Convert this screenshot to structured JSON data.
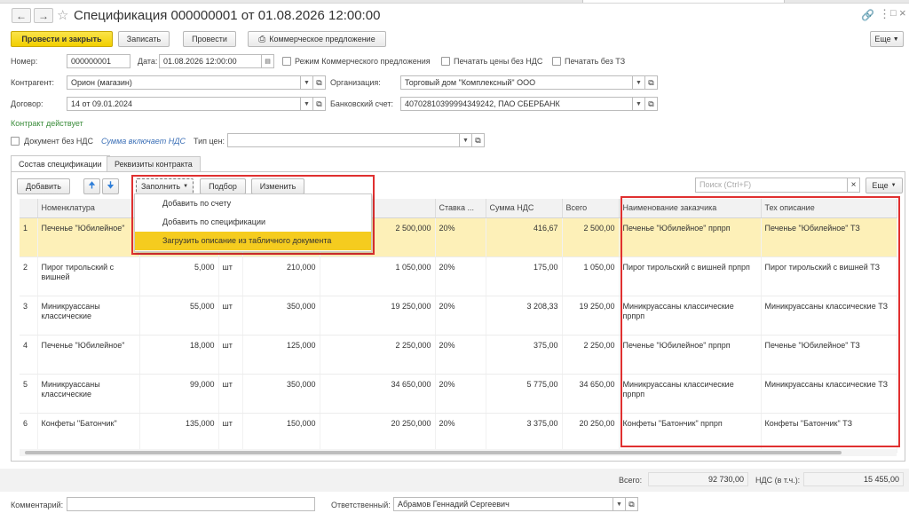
{
  "window": {
    "title": "Спецификация 000000001 от 01.08.2026 12:00:00"
  },
  "toolbar": {
    "post_close": "Провести и закрыть",
    "save": "Записать",
    "post": "Провести",
    "offer": "Коммерческое предложение",
    "more": "Еще"
  },
  "header": {
    "number_label": "Номер:",
    "number_value": "000000001",
    "date_label": "Дата:",
    "date_value": "01.08.2026 12:00:00",
    "commercial_mode": "Режим Коммерческого предложения",
    "print_no_vat": "Печатать цены без НДС",
    "print_no_tz": "Печатать без ТЗ",
    "counterparty_label": "Контрагент:",
    "counterparty_value": "Орион (магазин)",
    "organization_label": "Организация:",
    "organization_value": "Торговый дом \"Комплексный\" ООО",
    "contract_label": "Договор:",
    "contract_value": "14 от 09.01.2024",
    "bank_label": "Банковский счет:",
    "bank_value": "40702810399994349242, ПАО СБЕРБАНК",
    "contract_status": "Контракт действует",
    "doc_no_vat": "Документ без НДС",
    "sum_incl_vat": "Сумма включает НДС",
    "price_type_label": "Тип цен:"
  },
  "tabs": [
    "Состав спецификации",
    "Реквизиты контракта"
  ],
  "table_toolbar": {
    "add": "Добавить",
    "fill": "Заполнить",
    "pick": "Подбор",
    "change": "Изменить",
    "search_placeholder": "Поиск (Ctrl+F)",
    "more": "Еще"
  },
  "fill_menu": {
    "items": [
      "Добавить по счету",
      "Добавить по спецификации",
      "Загрузить описание из табличного документа"
    ]
  },
  "table": {
    "columns": [
      "",
      "Номенклатура",
      "",
      "",
      "",
      "",
      "Ставка ...",
      "Сумма НДС",
      "Всего",
      "Наименование заказчика",
      "Тех описание"
    ],
    "rows": [
      [
        "1",
        "Печенье \"Юбилейное\"",
        "",
        "",
        "",
        "2 500,000",
        "20%",
        "416,67",
        "2 500,00",
        "Печенье \"Юбилейное\" прпрп",
        "Печенье \"Юбилейное\" ТЗ"
      ],
      [
        "2",
        "Пирог тирольский с вишней",
        "5,000",
        "шт",
        "210,000",
        "1 050,000",
        "20%",
        "175,00",
        "1 050,00",
        "Пирог тирольский с вишней прпрп",
        "Пирог тирольский с вишней ТЗ"
      ],
      [
        "3",
        "Миникруассаны классические",
        "55,000",
        "шт",
        "350,000",
        "19 250,000",
        "20%",
        "3 208,33",
        "19 250,00",
        "Миникруассаны классические прпрп",
        "Миникруассаны классические ТЗ"
      ],
      [
        "4",
        "Печенье \"Юбилейное\"",
        "18,000",
        "шт",
        "125,000",
        "2 250,000",
        "20%",
        "375,00",
        "2 250,00",
        "Печенье \"Юбилейное\" прпрп",
        "Печенье \"Юбилейное\" ТЗ"
      ],
      [
        "5",
        "Миникруассаны классические",
        "99,000",
        "шт",
        "350,000",
        "34 650,000",
        "20%",
        "5 775,00",
        "34 650,00",
        "Миникруассаны классические прпрп",
        "Миникруассаны классические ТЗ"
      ],
      [
        "6",
        "Конфеты \"Батончик\"",
        "135,000",
        "шт",
        "150,000",
        "20 250,000",
        "20%",
        "3 375,00",
        "20 250,00",
        "Конфеты \"Батончик\" прпрп",
        "Конфеты \"Батончик\" ТЗ"
      ]
    ]
  },
  "totals": {
    "total_label": "Всего:",
    "total_value": "92 730,00",
    "vat_label": "НДС (в т.ч.):",
    "vat_value": "15 455,00"
  },
  "footer": {
    "comment_label": "Комментарий:",
    "responsible_label": "Ответственный:",
    "responsible_value": "Абрамов Геннадий Сергеевич"
  }
}
